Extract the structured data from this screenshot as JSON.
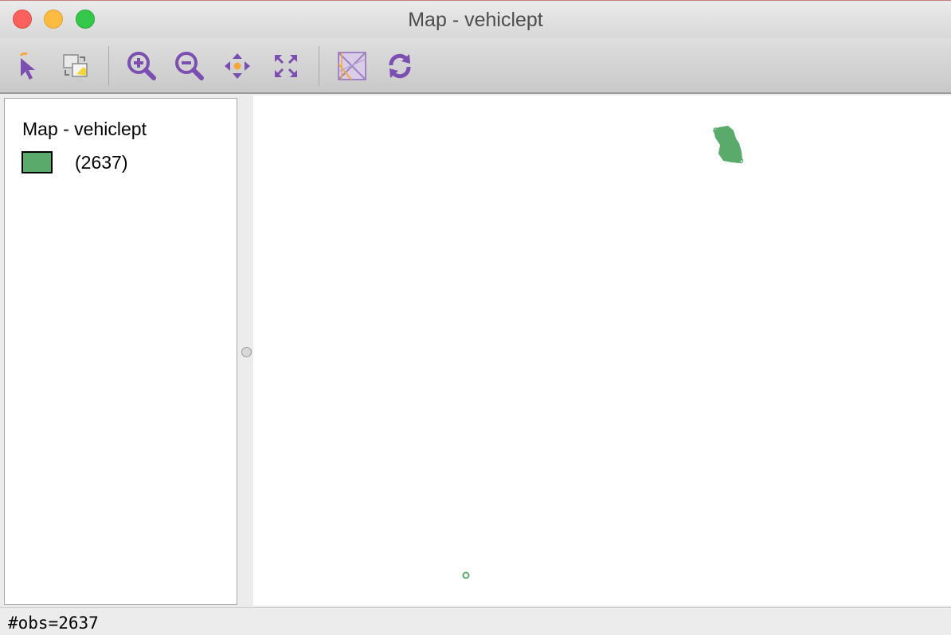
{
  "window": {
    "title": "Map - vehiclept"
  },
  "toolbar": {
    "buttons": [
      {
        "name": "select-tool",
        "icon": "pointer-arrow-icon"
      },
      {
        "name": "copy-map",
        "icon": "copy-image-icon"
      },
      {
        "name": "zoom-in",
        "icon": "zoom-in-icon"
      },
      {
        "name": "zoom-out",
        "icon": "zoom-out-icon"
      },
      {
        "name": "pan",
        "icon": "pan-arrows-icon"
      },
      {
        "name": "full-extent",
        "icon": "full-extent-icon"
      },
      {
        "name": "basemap",
        "icon": "basemap-icon"
      },
      {
        "name": "refresh",
        "icon": "refresh-icon"
      }
    ]
  },
  "legend": {
    "title": "Map - vehiclept",
    "category_label": "(2637)",
    "swatch_color": "#5aab6b"
  },
  "map": {
    "point_color": "#5aab6b",
    "features": [
      {
        "kind": "point-cluster",
        "label": "dense cluster of vehicle points"
      },
      {
        "kind": "isolated-point",
        "label": "single outlier point"
      }
    ]
  },
  "status": {
    "text": "#obs=2637"
  },
  "colors": {
    "icon_purple": "#7b4fb0",
    "icon_orange": "#f2a93b",
    "point_green": "#5aab6b"
  }
}
